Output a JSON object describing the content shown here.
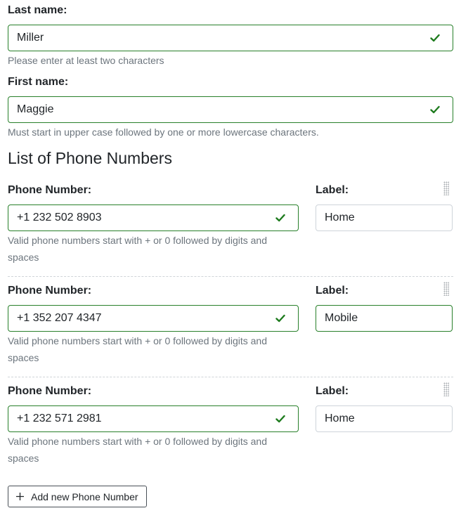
{
  "last_name": {
    "label": "Last name:",
    "value": "Miller",
    "help": "Please enter at least two characters"
  },
  "first_name": {
    "label": "First name:",
    "value": "Maggie",
    "help": "Must start in upper case followed by one or more lowercase characters."
  },
  "phones_heading": "List of Phone Numbers",
  "phones": [
    {
      "number_label": "Phone Number:",
      "number": "+1 232 502 8903",
      "help_line1": "Valid phone numbers start with + or 0 followed by digits and",
      "help_line2": "spaces",
      "label_label": "Label:",
      "label_value": "Home"
    },
    {
      "number_label": "Phone Number:",
      "number": "+1 352 207 4347",
      "help_line1": "Valid phone numbers start with + or 0 followed by digits and",
      "help_line2": "spaces",
      "label_label": "Label:",
      "label_value": "Mobile"
    },
    {
      "number_label": "Phone Number:",
      "number": "+1 232 571 2981",
      "help_line1": "Valid phone numbers start with + or 0 followed by digits and",
      "help_line2": "spaces",
      "label_label": "Label:",
      "label_value": "Home"
    }
  ],
  "add_button_label": "Add new Phone Number",
  "icons": {
    "valid": "check-icon",
    "drag": "drag-handle-icon",
    "add": "plus-icon"
  },
  "colors": {
    "valid_border": "#28802a",
    "check": "#1e7b1e",
    "help_text": "#6c757d"
  }
}
